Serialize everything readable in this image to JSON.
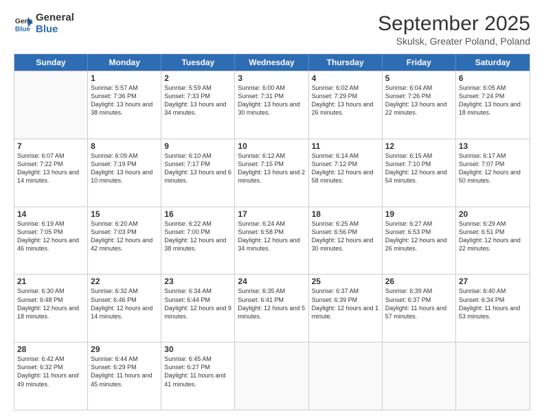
{
  "logo": {
    "general": "General",
    "blue": "Blue"
  },
  "header": {
    "month": "September 2025",
    "location": "Skulsk, Greater Poland, Poland"
  },
  "weekdays": [
    "Sunday",
    "Monday",
    "Tuesday",
    "Wednesday",
    "Thursday",
    "Friday",
    "Saturday"
  ],
  "rows": [
    [
      {
        "day": "",
        "sunrise": "",
        "sunset": "",
        "daylight": ""
      },
      {
        "day": "1",
        "sunrise": "Sunrise: 5:57 AM",
        "sunset": "Sunset: 7:36 PM",
        "daylight": "Daylight: 13 hours and 38 minutes."
      },
      {
        "day": "2",
        "sunrise": "Sunrise: 5:59 AM",
        "sunset": "Sunset: 7:33 PM",
        "daylight": "Daylight: 13 hours and 34 minutes."
      },
      {
        "day": "3",
        "sunrise": "Sunrise: 6:00 AM",
        "sunset": "Sunset: 7:31 PM",
        "daylight": "Daylight: 13 hours and 30 minutes."
      },
      {
        "day": "4",
        "sunrise": "Sunrise: 6:02 AM",
        "sunset": "Sunset: 7:29 PM",
        "daylight": "Daylight: 13 hours and 26 minutes."
      },
      {
        "day": "5",
        "sunrise": "Sunrise: 6:04 AM",
        "sunset": "Sunset: 7:26 PM",
        "daylight": "Daylight: 13 hours and 22 minutes."
      },
      {
        "day": "6",
        "sunrise": "Sunrise: 6:05 AM",
        "sunset": "Sunset: 7:24 PM",
        "daylight": "Daylight: 13 hours and 18 minutes."
      }
    ],
    [
      {
        "day": "7",
        "sunrise": "Sunrise: 6:07 AM",
        "sunset": "Sunset: 7:22 PM",
        "daylight": "Daylight: 13 hours and 14 minutes."
      },
      {
        "day": "8",
        "sunrise": "Sunrise: 6:09 AM",
        "sunset": "Sunset: 7:19 PM",
        "daylight": "Daylight: 13 hours and 10 minutes."
      },
      {
        "day": "9",
        "sunrise": "Sunrise: 6:10 AM",
        "sunset": "Sunset: 7:17 PM",
        "daylight": "Daylight: 13 hours and 6 minutes."
      },
      {
        "day": "10",
        "sunrise": "Sunrise: 6:12 AM",
        "sunset": "Sunset: 7:15 PM",
        "daylight": "Daylight: 13 hours and 2 minutes."
      },
      {
        "day": "11",
        "sunrise": "Sunrise: 6:14 AM",
        "sunset": "Sunset: 7:12 PM",
        "daylight": "Daylight: 12 hours and 58 minutes."
      },
      {
        "day": "12",
        "sunrise": "Sunrise: 6:15 AM",
        "sunset": "Sunset: 7:10 PM",
        "daylight": "Daylight: 12 hours and 54 minutes."
      },
      {
        "day": "13",
        "sunrise": "Sunrise: 6:17 AM",
        "sunset": "Sunset: 7:07 PM",
        "daylight": "Daylight: 12 hours and 50 minutes."
      }
    ],
    [
      {
        "day": "14",
        "sunrise": "Sunrise: 6:19 AM",
        "sunset": "Sunset: 7:05 PM",
        "daylight": "Daylight: 12 hours and 46 minutes."
      },
      {
        "day": "15",
        "sunrise": "Sunrise: 6:20 AM",
        "sunset": "Sunset: 7:03 PM",
        "daylight": "Daylight: 12 hours and 42 minutes."
      },
      {
        "day": "16",
        "sunrise": "Sunrise: 6:22 AM",
        "sunset": "Sunset: 7:00 PM",
        "daylight": "Daylight: 12 hours and 38 minutes."
      },
      {
        "day": "17",
        "sunrise": "Sunrise: 6:24 AM",
        "sunset": "Sunset: 6:58 PM",
        "daylight": "Daylight: 12 hours and 34 minutes."
      },
      {
        "day": "18",
        "sunrise": "Sunrise: 6:25 AM",
        "sunset": "Sunset: 6:56 PM",
        "daylight": "Daylight: 12 hours and 30 minutes."
      },
      {
        "day": "19",
        "sunrise": "Sunrise: 6:27 AM",
        "sunset": "Sunset: 6:53 PM",
        "daylight": "Daylight: 12 hours and 26 minutes."
      },
      {
        "day": "20",
        "sunrise": "Sunrise: 6:29 AM",
        "sunset": "Sunset: 6:51 PM",
        "daylight": "Daylight: 12 hours and 22 minutes."
      }
    ],
    [
      {
        "day": "21",
        "sunrise": "Sunrise: 6:30 AM",
        "sunset": "Sunset: 6:48 PM",
        "daylight": "Daylight: 12 hours and 18 minutes."
      },
      {
        "day": "22",
        "sunrise": "Sunrise: 6:32 AM",
        "sunset": "Sunset: 6:46 PM",
        "daylight": "Daylight: 12 hours and 14 minutes."
      },
      {
        "day": "23",
        "sunrise": "Sunrise: 6:34 AM",
        "sunset": "Sunset: 6:44 PM",
        "daylight": "Daylight: 12 hours and 9 minutes."
      },
      {
        "day": "24",
        "sunrise": "Sunrise: 6:35 AM",
        "sunset": "Sunset: 6:41 PM",
        "daylight": "Daylight: 12 hours and 5 minutes."
      },
      {
        "day": "25",
        "sunrise": "Sunrise: 6:37 AM",
        "sunset": "Sunset: 6:39 PM",
        "daylight": "Daylight: 12 hours and 1 minute."
      },
      {
        "day": "26",
        "sunrise": "Sunrise: 6:39 AM",
        "sunset": "Sunset: 6:37 PM",
        "daylight": "Daylight: 11 hours and 57 minutes."
      },
      {
        "day": "27",
        "sunrise": "Sunrise: 6:40 AM",
        "sunset": "Sunset: 6:34 PM",
        "daylight": "Daylight: 11 hours and 53 minutes."
      }
    ],
    [
      {
        "day": "28",
        "sunrise": "Sunrise: 6:42 AM",
        "sunset": "Sunset: 6:32 PM",
        "daylight": "Daylight: 11 hours and 49 minutes."
      },
      {
        "day": "29",
        "sunrise": "Sunrise: 6:44 AM",
        "sunset": "Sunset: 6:29 PM",
        "daylight": "Daylight: 11 hours and 45 minutes."
      },
      {
        "day": "30",
        "sunrise": "Sunrise: 6:45 AM",
        "sunset": "Sunset: 6:27 PM",
        "daylight": "Daylight: 11 hours and 41 minutes."
      },
      {
        "day": "",
        "sunrise": "",
        "sunset": "",
        "daylight": ""
      },
      {
        "day": "",
        "sunrise": "",
        "sunset": "",
        "daylight": ""
      },
      {
        "day": "",
        "sunrise": "",
        "sunset": "",
        "daylight": ""
      },
      {
        "day": "",
        "sunrise": "",
        "sunset": "",
        "daylight": ""
      }
    ]
  ]
}
